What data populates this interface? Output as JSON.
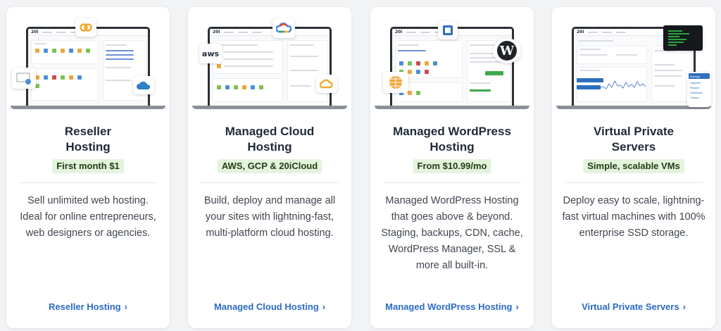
{
  "cards": [
    {
      "title_line1": "Reseller",
      "title_line2": "Hosting",
      "tag": "First month $1",
      "description": "Sell unlimited web hosting. Ideal for online entrepreneurs, web designers or agencies.",
      "link": "Reseller Hosting",
      "screen_logo": "20i",
      "badges": [
        "brand-logo-icon",
        "cloud-icon",
        "users-icon"
      ]
    },
    {
      "title_line1": "Managed Cloud",
      "title_line2": "Hosting",
      "tag": "AWS, GCP & 20iCloud",
      "description": "Build, deploy and manage all your sites with lightning-fast, multi-platform cloud hosting.",
      "link": "Managed Cloud Hosting",
      "screen_logo": "20i",
      "badge_aws": "aws",
      "badges": [
        "aws-logo-icon",
        "google-cloud-icon",
        "20i-cloud-icon"
      ]
    },
    {
      "title_line1": "Managed WordPress",
      "title_line2": "Hosting",
      "tag": "From $10.99/mo",
      "description": "Managed WordPress Hosting that goes above & beyond. Staging, backups, CDN, cache, WordPress Manager, SSL & more all built-in.",
      "link": "Managed WordPress Hosting",
      "screen_logo": "20i",
      "badge_wp": "W",
      "badges": [
        "wordpress-logo-icon",
        "dashboard-icon",
        "globe-icon"
      ]
    },
    {
      "title_line1": "Virtual Private",
      "title_line2": "Servers",
      "tag": "Simple, scalable VMs",
      "description": "Deploy easy to scale, lightning-fast virtual machines with 100% enterprise SSD storage.",
      "link": "Virtual Private Servers",
      "screen_logo": "20i",
      "menu_items": [
        "Manage",
        "Upgrade",
        "Restart",
        "Shutdown",
        "Cancel"
      ],
      "badges": [
        "terminal-icon",
        "context-menu-icon"
      ]
    }
  ],
  "colors": {
    "tag_bg": "#e3f3dc",
    "link": "#2a6bc5",
    "title": "#1f2937",
    "body_text": "#3f4650"
  },
  "link_chevron": "›"
}
